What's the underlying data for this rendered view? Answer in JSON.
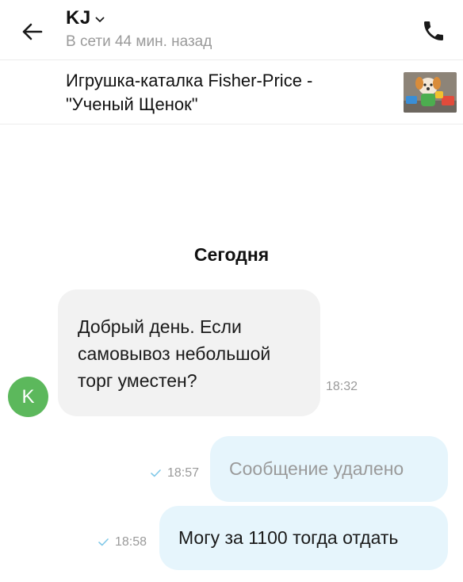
{
  "header": {
    "contact_name": "KJ",
    "status": "В сети 44 мин. назад"
  },
  "listing": {
    "title": "Игрушка-каталка Fisher-Price - \"Ученый Щенок\""
  },
  "chat": {
    "date_separator": "Сегодня",
    "avatar_letter": "K",
    "messages": [
      {
        "direction": "in",
        "text": "Добрый день. Если самовывоз небольшой торг уместен?",
        "time": "18:32"
      },
      {
        "direction": "out",
        "text": "Сообщение удалено",
        "time": "18:57",
        "status": "sent"
      },
      {
        "direction": "out",
        "text": "Могу за 1100 тогда отдать",
        "time": "18:58",
        "status": "sent"
      }
    ]
  },
  "colors": {
    "incoming_bubble": "#f2f2f2",
    "outgoing_bubble": "#e6f5fc",
    "avatar": "#5cb85c",
    "muted_text": "#9a9a9a",
    "check_mark": "#7fc8e8"
  },
  "icons": {
    "back": "arrow-left-icon",
    "dropdown": "chevron-down-icon",
    "call": "phone-icon",
    "sent": "check-icon"
  }
}
